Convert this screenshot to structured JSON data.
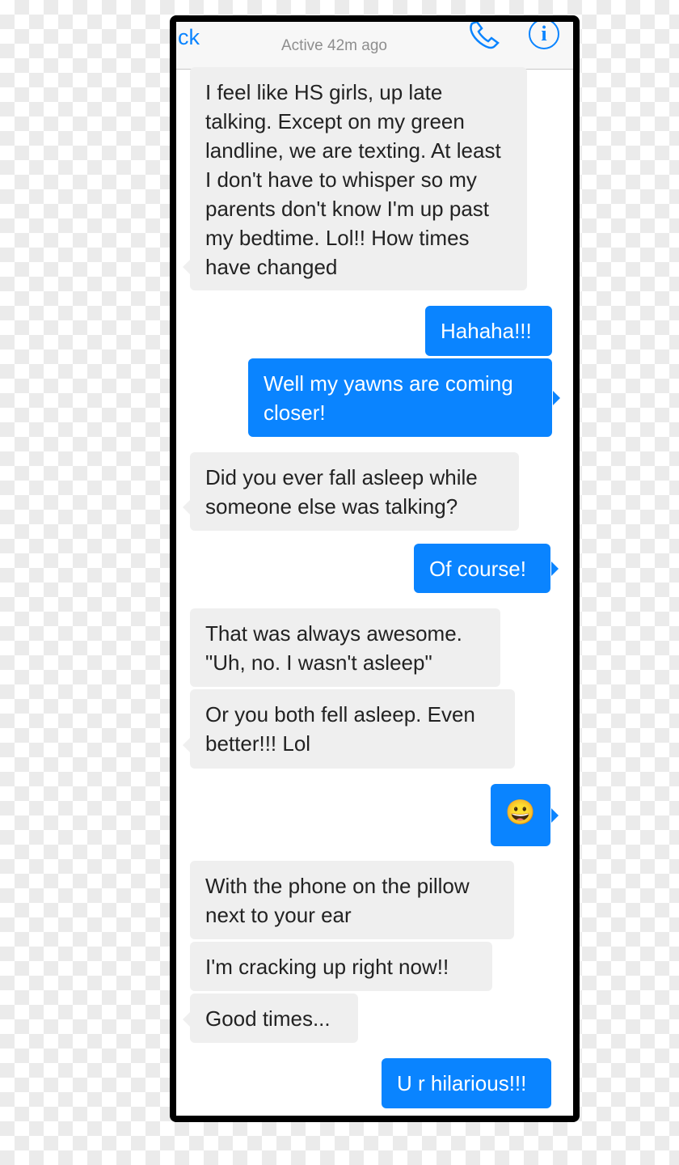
{
  "header": {
    "back_label": "ck",
    "status": "Active 42m ago",
    "icons": [
      "phone-icon",
      "info-icon"
    ]
  },
  "messages": [
    {
      "side": "in",
      "text": "I feel like HS girls, up late talking. Except on my green landline, we are texting. At least I don't have to whisper so my parents don't know I'm up past my bedtime. Lol!! How times have changed"
    },
    {
      "side": "out",
      "text": "Hahaha!!!"
    },
    {
      "side": "out",
      "text": "Well my yawns are coming closer!"
    },
    {
      "side": "in",
      "text": "Did you ever fall asleep while someone else was talking?"
    },
    {
      "side": "out",
      "text": "Of course!"
    },
    {
      "side": "in",
      "text": "That was always awesome. \"Uh, no. I wasn't asleep\""
    },
    {
      "side": "in",
      "text": "Or you both fell asleep. Even better!!! Lol"
    },
    {
      "side": "out",
      "text": "😀"
    },
    {
      "side": "in",
      "text": "With the phone on the pillow next to your ear"
    },
    {
      "side": "in",
      "text": "I'm cracking up right now!!"
    },
    {
      "side": "in",
      "text": "Good times..."
    },
    {
      "side": "out",
      "text": "U r hilarious!!!"
    }
  ],
  "colors": {
    "outgoing": "#0a84ff",
    "incoming": "#efefef"
  }
}
